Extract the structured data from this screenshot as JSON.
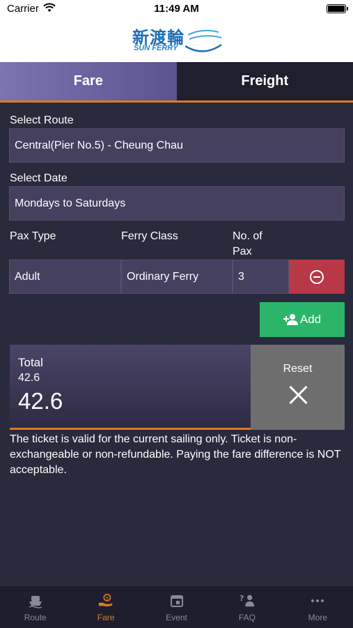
{
  "status_bar": {
    "carrier": "Carrier",
    "time": "11:49 AM"
  },
  "logo": {
    "cn": "新渡輪",
    "en": "SUN FERRY"
  },
  "tabs": [
    {
      "label": "Fare",
      "active": true
    },
    {
      "label": "Freight",
      "active": false
    }
  ],
  "form": {
    "route_label": "Select Route",
    "route_value": "Central(Pier No.5) - Cheung Chau",
    "date_label": "Select Date",
    "date_value": "Mondays to Saturdays",
    "pax_type_label": "Pax Type",
    "ferry_class_label": "Ferry Class",
    "no_of_pax_label_1": "No. of",
    "no_of_pax_label_2": "Pax",
    "pax_type_value": "Adult",
    "ferry_class_value": "Ordinary Ferry",
    "no_of_pax_value": "3",
    "add_label": "Add"
  },
  "total": {
    "label": "Total",
    "small_value": "42.6",
    "big_value": "42.6"
  },
  "reset_label": "Reset",
  "notice": "The ticket is valid for the current sailing only. Ticket is non-exchangeable or non-refundable. Paying the fare difference is NOT acceptable.",
  "bottom_nav": [
    {
      "label": "Route",
      "icon": "ferry-icon",
      "active": false
    },
    {
      "label": "Fare",
      "icon": "fare-icon",
      "active": true
    },
    {
      "label": "Event",
      "icon": "calendar-icon",
      "active": false
    },
    {
      "label": "FAQ",
      "icon": "faq-icon",
      "active": false
    },
    {
      "label": "More",
      "icon": "more-icon",
      "active": false
    }
  ],
  "colors": {
    "accent": "#e07a1f",
    "add_green": "#2bb56b",
    "remove_red": "#b83848",
    "tab_active": "#7b74b0",
    "background": "#2a2a3d"
  }
}
